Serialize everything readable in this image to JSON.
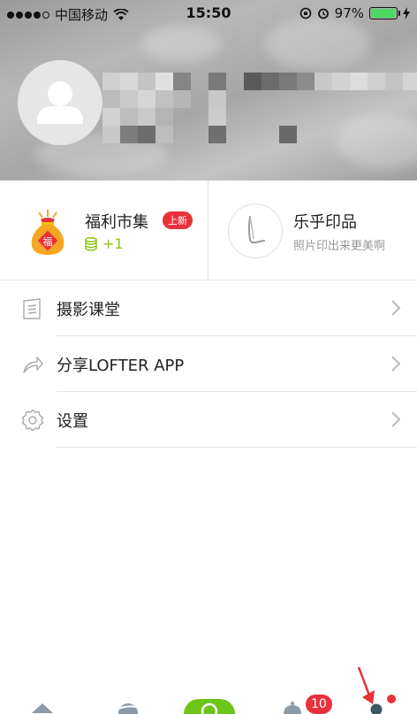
{
  "status_bar": {
    "carrier": "中国移动",
    "time": "15:50",
    "battery": "97%",
    "battery_level": 0.97
  },
  "features": {
    "fuli": {
      "title": "福利市集",
      "badge": "上新",
      "coins": "+1",
      "bag_char": "福"
    },
    "lofter_print": {
      "title": "乐乎印品",
      "subtitle": "照片印出来更美啊"
    }
  },
  "menu": [
    {
      "label": "摄影课堂",
      "icon": "book-icon"
    },
    {
      "label": "分享LOFTER APP",
      "icon": "share-icon"
    },
    {
      "label": "设置",
      "icon": "gear-icon"
    }
  ],
  "bottom_nav": {
    "notification_count": "10"
  },
  "colors": {
    "accent_red": "#e8313b",
    "coin_green": "#8dc21f",
    "brand_green": "#6ec51a"
  }
}
